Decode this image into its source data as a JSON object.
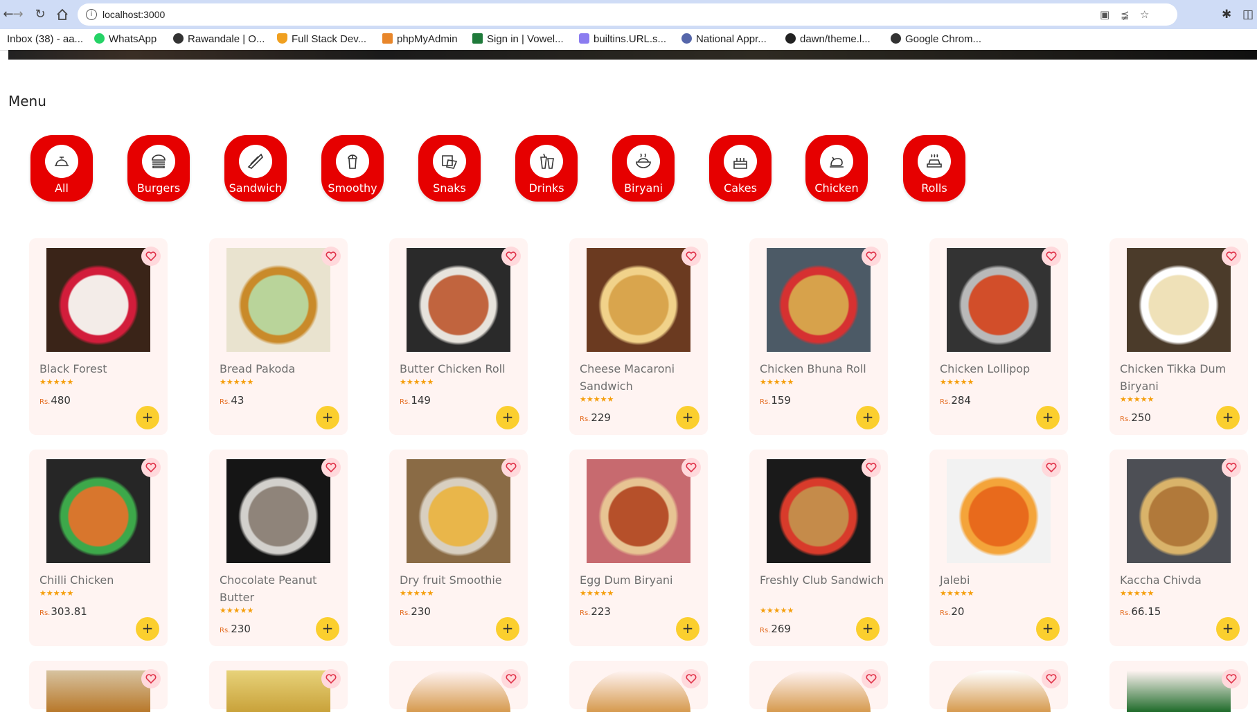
{
  "browser": {
    "url": "localhost:3000",
    "bookmarks": [
      {
        "label": "Inbox (38) - aa...",
        "icon": "gmail-icon"
      },
      {
        "label": "WhatsApp",
        "icon": "whatsapp-icon"
      },
      {
        "label": "Rawandale | O...",
        "icon": "globe-icon"
      },
      {
        "label": "Full Stack Dev...",
        "icon": "bookmark-orange-icon"
      },
      {
        "label": "phpMyAdmin",
        "icon": "phpmyadmin-icon"
      },
      {
        "label": "Sign in | Vowel...",
        "icon": "vowel-icon"
      },
      {
        "label": "builtins.URL.s...",
        "icon": "hexagon-icon"
      },
      {
        "label": "National Appr...",
        "icon": "national-icon"
      },
      {
        "label": "dawn/theme.l...",
        "icon": "github-icon"
      },
      {
        "label": "Google Chrom...",
        "icon": "chrome-icon"
      }
    ]
  },
  "page": {
    "menu_title": "Menu",
    "categories": [
      {
        "label": "All",
        "icon": "cloche-icon"
      },
      {
        "label": "Burgers",
        "icon": "burger-icon"
      },
      {
        "label": "Sandwich",
        "icon": "sandwich-icon"
      },
      {
        "label": "Smoothy",
        "icon": "smoothie-icon"
      },
      {
        "label": "Snaks",
        "icon": "snacks-icon"
      },
      {
        "label": "Drinks",
        "icon": "drinks-icon"
      },
      {
        "label": "Biryani",
        "icon": "biryani-icon"
      },
      {
        "label": "Cakes",
        "icon": "cake-icon"
      },
      {
        "label": "Chicken",
        "icon": "chicken-icon"
      },
      {
        "label": "Rolls",
        "icon": "rolls-icon"
      }
    ],
    "products": [
      {
        "name": "Black Forest",
        "currency": "Rs.",
        "price": "480",
        "rating": 5
      },
      {
        "name": "Bread Pakoda",
        "currency": "Rs.",
        "price": "43",
        "rating": 5
      },
      {
        "name": "Butter Chicken Roll",
        "currency": "Rs.",
        "price": "149",
        "rating": 5
      },
      {
        "name": "Cheese Macaroni Sandwich",
        "currency": "Rs.",
        "price": "229",
        "rating": 5
      },
      {
        "name": "Chicken Bhuna Roll",
        "currency": "Rs.",
        "price": "159",
        "rating": 5
      },
      {
        "name": "Chicken Lollipop",
        "currency": "Rs.",
        "price": "284",
        "rating": 5
      },
      {
        "name": "Chicken Tikka Dum Biryani",
        "currency": "Rs.",
        "price": "250",
        "rating": 5
      },
      {
        "name": "Chilli Chicken",
        "currency": "Rs.",
        "price": "303.81",
        "rating": 5
      },
      {
        "name": "Chocolate Peanut Butter",
        "currency": "Rs.",
        "price": "230",
        "rating": 5
      },
      {
        "name": "Dry fruit Smoothie",
        "currency": "Rs.",
        "price": "230",
        "rating": 5
      },
      {
        "name": "Egg Dum Biryani",
        "currency": "Rs.",
        "price": "223",
        "rating": 5
      },
      {
        "name": "Freshly Club Sandwich",
        "currency": "Rs.",
        "price": "269",
        "rating": 5
      },
      {
        "name": "Jalebi",
        "currency": "Rs.",
        "price": "20",
        "rating": 5
      },
      {
        "name": "Kaccha Chivda",
        "currency": "Rs.",
        "price": "66.15",
        "rating": 5
      }
    ],
    "star_glyphs": "★★★★★",
    "add_symbol": "+"
  }
}
